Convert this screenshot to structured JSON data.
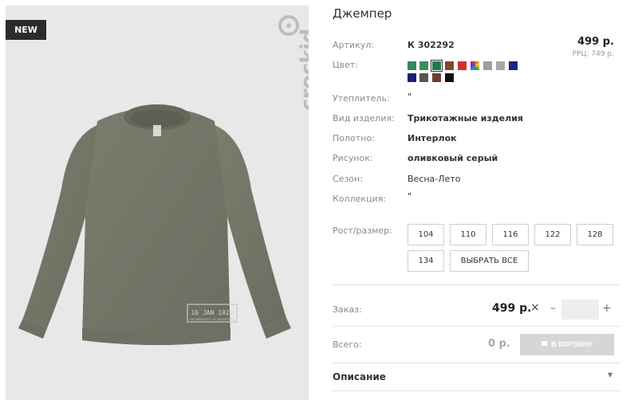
{
  "badge": "NEW",
  "brand": "crockid",
  "sweater_print": {
    "line1": "16 JAN 1920",
    "line2": "AN UNIVERSITY OF ADVENTURE"
  },
  "product": {
    "title": "Джемпер",
    "article_label": "Артикул:",
    "article_value": "К 302292",
    "price": "499 р.",
    "rrp": "РРЦ: 749 р.",
    "color_label": "Цвет:",
    "insulation_label": "Утеплитель:",
    "insulation_value": "\"",
    "kind_label": "Вид изделия:",
    "kind_value": "Трикотажные изделия",
    "fabric_label": "Полотно:",
    "fabric_value": "Интерлок",
    "pattern_label": "Рисунок:",
    "pattern_value": "оливковый серый",
    "season_label": "Сезон:",
    "season_value": "Весна-Лето",
    "collection_label": "Коллекция:",
    "collection_value": "\"",
    "size_label": "Рост/размер:"
  },
  "colors": [
    "#2e8b57",
    "#3a8f5c",
    "#1f7a4b",
    "#7a4a33",
    "#d32f2f",
    "rainbow",
    "#9e9e9e",
    "#a7a7a7",
    "#1a237e",
    "#1c1f7a",
    "#555555",
    "#6a4232",
    "#111111"
  ],
  "selected_color_index": 2,
  "sizes": [
    "104",
    "110",
    "116",
    "122",
    "128",
    "134"
  ],
  "select_all_label": "ВЫБРАТЬ ВСЕ",
  "order": {
    "label": "Заказ:",
    "price": "499 р.",
    "times": "×",
    "minus": "–",
    "plus": "+",
    "qty": ""
  },
  "total": {
    "label": "Всего:",
    "value": "0 р.",
    "cart_label": "В КОРЗИНУ"
  },
  "description_label": "Описание",
  "description_arrow": "▼"
}
